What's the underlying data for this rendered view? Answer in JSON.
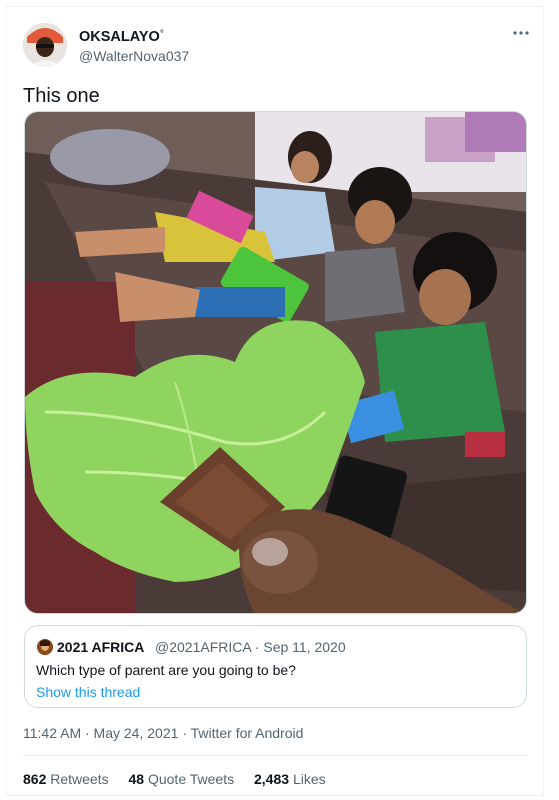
{
  "tweet": {
    "author_name": "OKSALAYO",
    "author_name_suffix": "°",
    "author_handle": "@WalterNova037",
    "more_icon": "more-options-icon",
    "text": "This one",
    "timestamp": "11:42 AM · May 24, 2021 · Twitter for Android"
  },
  "quoted_tweet": {
    "author_name": "2021 AFRICA",
    "meta": "@2021AFRICA · Sep 11, 2020",
    "text": "Which type of parent are you going to be?",
    "link": "Show this thread"
  },
  "stats": [
    {
      "count": "862",
      "label": "Retweets"
    },
    {
      "count": "48",
      "label": "Quote Tweets"
    },
    {
      "count": "2,483",
      "label": "Likes"
    }
  ],
  "colors": {
    "link": "#1d9bf0",
    "secondary_text": "#536471",
    "border": "#cfd9de"
  }
}
